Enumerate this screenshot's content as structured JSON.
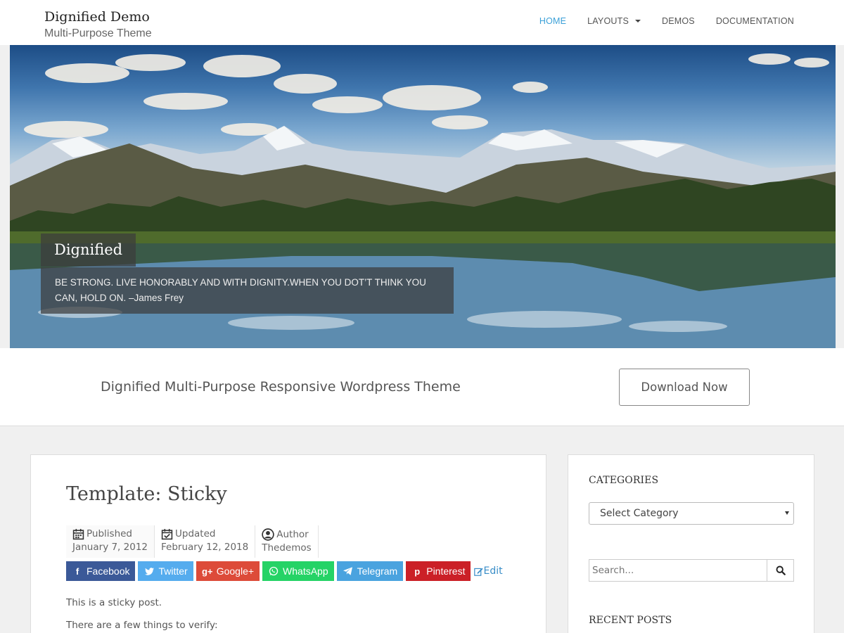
{
  "header": {
    "site_title": "Dignified Demo",
    "tagline": "Multi-Purpose Theme",
    "nav": [
      {
        "label": "HOME",
        "active": true
      },
      {
        "label": "LAYOUTS",
        "dropdown": true
      },
      {
        "label": "DEMOS"
      },
      {
        "label": "DOCUMENTATION"
      }
    ]
  },
  "hero": {
    "caption_title": "Dignified",
    "caption_text": "BE STRONG. LIVE HONORABLY AND WITH DIGNITY.WHEN YOU DOT’T THINK YOU CAN, HOLD ON. –James Frey"
  },
  "cta": {
    "text": "Dignified Multi-Purpose Responsive Wordpress Theme",
    "button_label": "Download Now"
  },
  "post": {
    "title": "Template: Sticky",
    "meta": {
      "published_label": "Published",
      "published_date": "January 7, 2012",
      "updated_label": "Updated",
      "updated_date": "February 12, 2018",
      "author_label": "Author",
      "author_name": "Thedemos"
    },
    "share": [
      {
        "label": "Facebook",
        "icon": "facebook-icon",
        "color": "#3b5998"
      },
      {
        "label": "Twitter",
        "icon": "twitter-icon",
        "color": "#55acee"
      },
      {
        "label": "Google+",
        "icon": "google-plus-icon",
        "color": "#dd4b39"
      },
      {
        "label": "WhatsApp",
        "icon": "whatsapp-icon",
        "color": "#25d366"
      },
      {
        "label": "Telegram",
        "icon": "telegram-icon",
        "color": "#4aa3df"
      },
      {
        "label": "Pinterest",
        "icon": "pinterest-icon",
        "color": "#cb2027"
      }
    ],
    "edit_label": "Edit",
    "paragraphs": [
      "This is a sticky post.",
      "There are a few things to verify:"
    ]
  },
  "sidebar": {
    "categories_title": "CATEGORIES",
    "select_value": "Select Category",
    "search_placeholder": "Search...",
    "recent_title": "RECENT POSTS"
  },
  "colors": {
    "accent": "#3aa0d8",
    "link": "#3a8ec8"
  }
}
